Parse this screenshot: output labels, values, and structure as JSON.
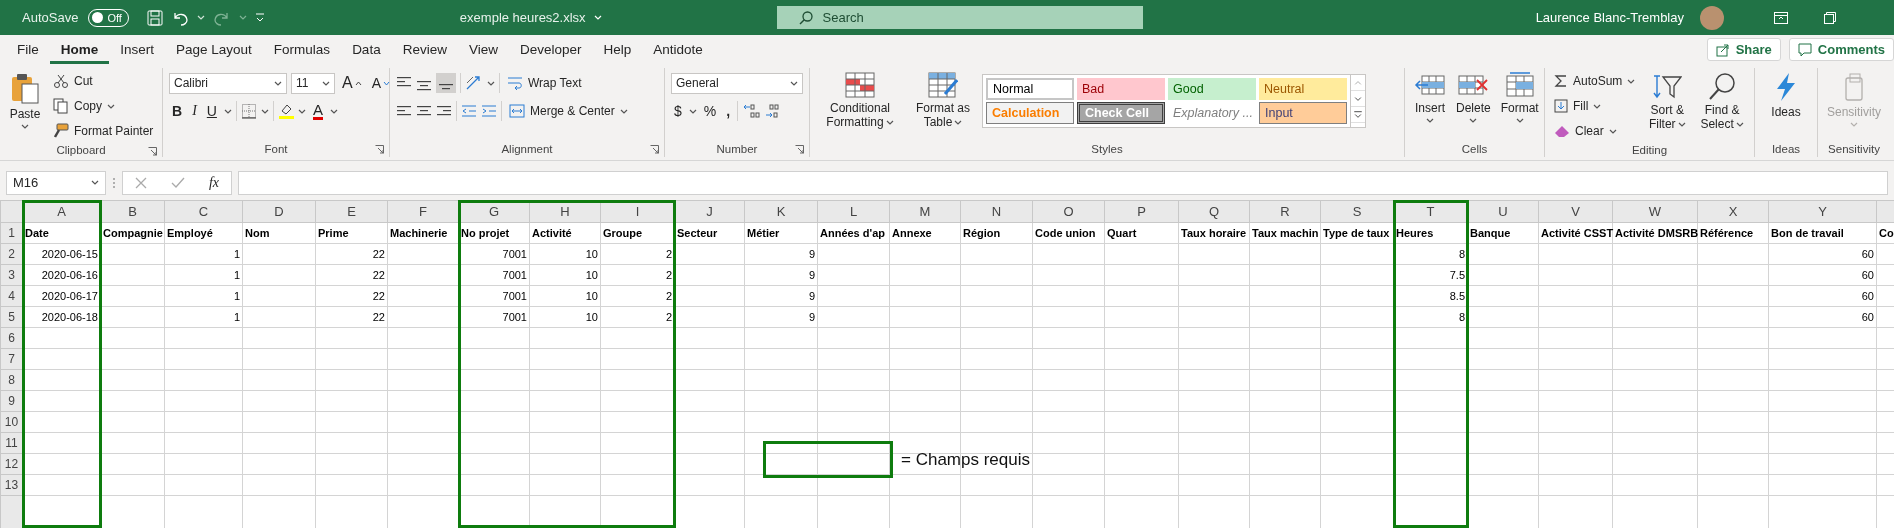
{
  "title_bar": {
    "autosave_label": "AutoSave",
    "autosave_toggle": {
      "label": "Off",
      "on": false
    },
    "file_name": "exemple heures2.xlsx",
    "search": {
      "placeholder": "Search"
    },
    "user_name": "Laurence Blanc-Tremblay"
  },
  "ribbon_tabs": [
    {
      "label": "File",
      "selected": false
    },
    {
      "label": "Home",
      "selected": true
    },
    {
      "label": "Insert",
      "selected": false
    },
    {
      "label": "Page Layout",
      "selected": false
    },
    {
      "label": "Formulas",
      "selected": false
    },
    {
      "label": "Data",
      "selected": false
    },
    {
      "label": "Review",
      "selected": false
    },
    {
      "label": "View",
      "selected": false
    },
    {
      "label": "Developer",
      "selected": false
    },
    {
      "label": "Help",
      "selected": false
    },
    {
      "label": "Antidote",
      "selected": false
    }
  ],
  "share_button": "Share",
  "comments_button": "Comments",
  "ribbon": {
    "groups": [
      {
        "kind": "clipboard",
        "label": "Clipboard",
        "paste": "Paste",
        "cut": "Cut",
        "copy": "Copy",
        "format_painter": "Format Painter"
      },
      {
        "kind": "font",
        "label": "Font",
        "font_name": "Calibri",
        "font_size": "11",
        "grow": "A",
        "shrink": "A",
        "bold": "B",
        "italic": "I",
        "underline": "U",
        "font_color": "A"
      },
      {
        "kind": "alignment",
        "label": "Alignment",
        "wrap_text": "Wrap Text",
        "merge_center": "Merge & Center"
      },
      {
        "kind": "number",
        "label": "Number",
        "format": "General",
        "currency": "$",
        "percent": "%",
        "comma": ","
      },
      {
        "kind": "styles",
        "label": "Styles",
        "conditional_formatting": "Conditional Formatting",
        "format_as_table": "Format as Table",
        "cell_styles": [
          {
            "label": "Normal",
            "kind": "normal"
          },
          {
            "label": "Bad",
            "kind": "bad"
          },
          {
            "label": "Good",
            "kind": "good"
          },
          {
            "label": "Neutral",
            "kind": "neutral"
          },
          {
            "label": "Calculation",
            "kind": "calculation"
          },
          {
            "label": "Check Cell",
            "kind": "check"
          },
          {
            "label": "Explanatory ...",
            "kind": "explanatory"
          },
          {
            "label": "Input",
            "kind": "input"
          }
        ]
      },
      {
        "kind": "cells",
        "label": "Cells",
        "buttons": [
          {
            "label": "Insert",
            "kind": "insert"
          },
          {
            "label": "Delete",
            "kind": "delete"
          },
          {
            "label": "Format",
            "kind": "format"
          }
        ]
      },
      {
        "kind": "editing",
        "label": "Editing",
        "autosum": "AutoSum",
        "fill": "Fill",
        "clear": "Clear",
        "sort_filter": "Sort & Filter",
        "find_select": "Find & Select"
      },
      {
        "kind": "ideas",
        "label": "Ideas",
        "button": "Ideas"
      },
      {
        "kind": "sensitivity",
        "label": "Sensitivity",
        "button": "Sensitivity",
        "disabled": true
      }
    ]
  },
  "formula_bar": {
    "name_box": "M16",
    "function_label": "fx"
  },
  "sheet": {
    "columns": [
      {
        "letter": "A",
        "required": true
      },
      {
        "letter": "B",
        "required": false
      },
      {
        "letter": "C",
        "required": false
      },
      {
        "letter": "D",
        "required": false
      },
      {
        "letter": "E",
        "required": false
      },
      {
        "letter": "F",
        "required": false
      },
      {
        "letter": "G",
        "required": true
      },
      {
        "letter": "H",
        "required": true
      },
      {
        "letter": "I",
        "required": true
      },
      {
        "letter": "J",
        "required": false
      },
      {
        "letter": "K",
        "required": false
      },
      {
        "letter": "L",
        "required": false
      },
      {
        "letter": "M",
        "required": false
      },
      {
        "letter": "N",
        "required": false
      },
      {
        "letter": "O",
        "required": false
      },
      {
        "letter": "P",
        "required": false
      },
      {
        "letter": "Q",
        "required": false
      },
      {
        "letter": "R",
        "required": false
      },
      {
        "letter": "S",
        "required": false
      },
      {
        "letter": "T",
        "required": true
      },
      {
        "letter": "U",
        "required": false
      },
      {
        "letter": "V",
        "required": false
      },
      {
        "letter": "W",
        "required": false
      },
      {
        "letter": "X",
        "required": false
      },
      {
        "letter": "Y",
        "required": false
      },
      {
        "required": false
      }
    ],
    "rows": [
      {
        "number": "1",
        "bold": true,
        "cells": [
          "Date",
          "Compagnie",
          "Employé",
          "Nom",
          "Prime",
          "Machinerie",
          "No projet",
          "Activité",
          "Groupe",
          "Secteur",
          "Métier",
          "Années d'ap",
          "Annexe",
          "Région",
          "Code union",
          "Quart",
          "Taux horaire",
          "Taux machin",
          "Type de taux",
          "Heures",
          "Banque",
          "Activité CSST",
          "Activité DMSRB",
          "Référence",
          "Bon de travail",
          "Co"
        ]
      },
      {
        "number": "2",
        "bold": false,
        "cells": [
          "2020-06-15",
          null,
          "1",
          null,
          "22",
          null,
          "7001",
          "10",
          "2",
          null,
          "9",
          null,
          null,
          null,
          null,
          null,
          null,
          null,
          null,
          "8",
          null,
          null,
          null,
          null,
          "60"
        ]
      },
      {
        "number": "3",
        "bold": false,
        "cells": [
          "2020-06-16",
          null,
          "1",
          null,
          "22",
          null,
          "7001",
          "10",
          "2",
          null,
          "9",
          null,
          null,
          null,
          null,
          null,
          null,
          null,
          null,
          "7.5",
          null,
          null,
          null,
          null,
          "60"
        ]
      },
      {
        "number": "4",
        "bold": false,
        "cells": [
          "2020-06-17",
          null,
          "1",
          null,
          "22",
          null,
          "7001",
          "10",
          "2",
          null,
          "9",
          null,
          null,
          null,
          null,
          null,
          null,
          null,
          null,
          "8.5",
          null,
          null,
          null,
          null,
          "60"
        ]
      },
      {
        "number": "5",
        "bold": false,
        "cells": [
          "2020-06-18",
          null,
          "1",
          null,
          "22",
          null,
          "7001",
          "10",
          "2",
          null,
          "9",
          null,
          null,
          null,
          null,
          null,
          null,
          null,
          null,
          "8",
          null,
          null,
          null,
          null,
          "60"
        ]
      },
      {
        "number": "6"
      },
      {
        "number": "7"
      },
      {
        "number": "8"
      },
      {
        "number": "9"
      },
      {
        "number": "10"
      },
      {
        "number": "11"
      },
      {
        "number": "12"
      },
      {
        "number": "13"
      }
    ],
    "legend": {
      "text": "= Champs requis"
    }
  }
}
